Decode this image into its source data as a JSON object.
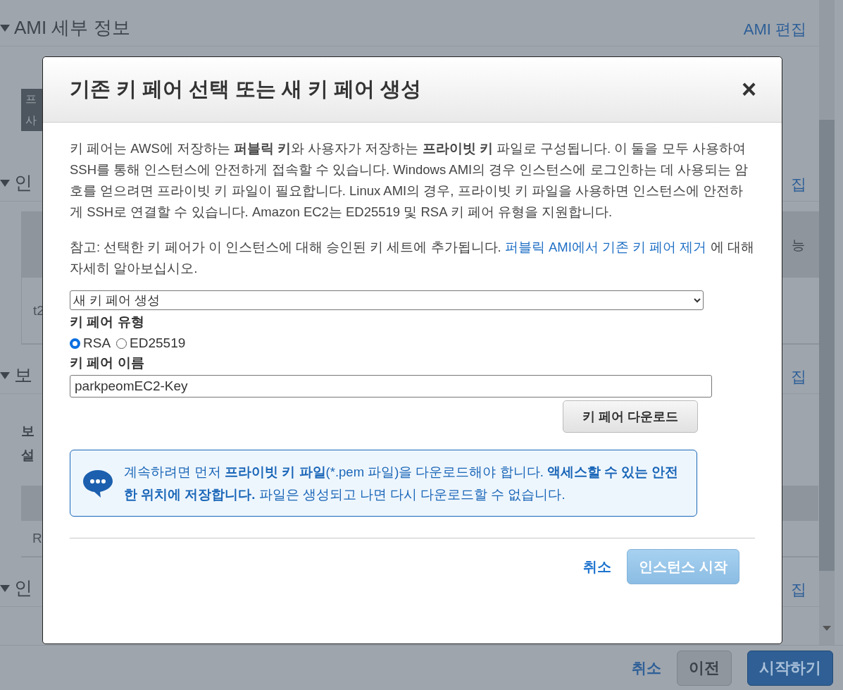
{
  "page": {
    "sections": [
      {
        "title": "AMI 세부 정보",
        "edit_link": "AMI 편집"
      },
      {
        "title": "인",
        "edit_link": "집"
      },
      {
        "title": "보",
        "edit_link": "집"
      },
      {
        "title": "인",
        "edit_link": "집"
      }
    ],
    "ami_tag": [
      "프",
      "사"
    ],
    "instance_table": {
      "header_end": "능",
      "row": "t2"
    },
    "security_labels": [
      "보",
      "설"
    ],
    "rule_table": {
      "row": "R"
    },
    "footer": {
      "cancel": "취소",
      "previous": "이전",
      "launch": "시작하기"
    }
  },
  "modal": {
    "title": "기존 키 페어 선택 또는 새 키 페어 생성",
    "close": "×",
    "intro": "키 페어는 AWS에 저장하는 **퍼블릭 키**와 사용자가 저장하는 **프라이빗 키** 파일로 구성됩니다. 이 둘을 모두 사용하여 SSH를 통해 인스턴스에 안전하게 접속할 수 있습니다. Windows AMI의 경우 인스턴스에 로그인하는 데 사용되는 암호를 얻으려면 프라이빗 키 파일이 필요합니다. Linux AMI의 경우, 프라이빗 키 파일을 사용하면 인스턴스에 안전하게 SSH로 연결할 수 있습니다. Amazon EC2는 ED25519 및 RSA 키 페어 유형을 지원합니다.",
    "note": "참고: 선택한 키 페어가 이 인스턴스에 대해 승인된 키 세트에 추가됩니다.",
    "note_link": "퍼블릭 AMI에서 기존 키 페어 제거",
    "note_end": "에 대해 자세히 알아보십시오.",
    "key_pair_select": "새 키 페어 생성",
    "type_label": "키 페어 유형",
    "types": [
      {
        "label": "RSA",
        "selected": true
      },
      {
        "label": "ED25519",
        "selected": false
      }
    ],
    "name_label": "키 페어 이름",
    "name_value": "parkpeomEC2-Key",
    "download_button": "키 페어 다운로드",
    "info": [
      {
        "text": "계속하려면 먼저 ",
        "bold": false
      },
      {
        "text": "프라이빗 키 파일",
        "bold": true
      },
      {
        "text": "(*.pem 파일)을 다운로드해야 합니다. ",
        "bold": false
      },
      {
        "text": "액세스할 수 있는 안전한 위치에 저장합니다.",
        "bold": true
      },
      {
        "text": " 파일은 생성되고 나면 다시 다운로드할 수 없습니다.",
        "bold": false
      }
    ],
    "cancel": "취소",
    "launch": {
      "label": "인스턴스 시작",
      "disabled": true
    }
  }
}
